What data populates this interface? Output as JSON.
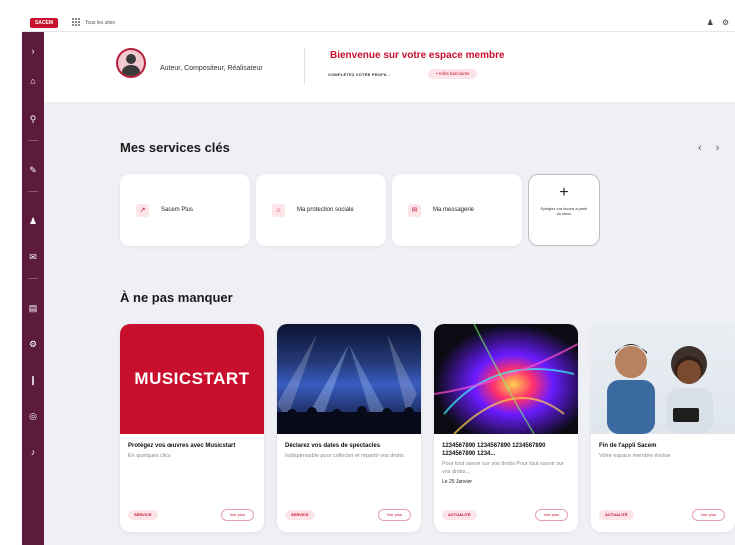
{
  "topbar": {
    "logo_text": "SACEM",
    "apps_label": "Tous les sites",
    "user_icon": "user-icon",
    "settings_icon": "gear-icon"
  },
  "sidebar": {
    "items": [
      {
        "icon": "chevron-right-icon",
        "glyph": "›"
      },
      {
        "icon": "home-icon",
        "glyph": "⌂"
      },
      {
        "icon": "search-icon",
        "glyph": "⚲"
      },
      {
        "icon": "pencil-icon",
        "glyph": "✎"
      },
      {
        "icon": "user-icon",
        "glyph": "♟"
      },
      {
        "icon": "mail-icon",
        "glyph": "✉"
      },
      {
        "icon": "document-icon",
        "glyph": "▤"
      },
      {
        "icon": "settings-icon",
        "glyph": "⚙"
      },
      {
        "icon": "microphone-icon",
        "glyph": "❙"
      },
      {
        "icon": "money-icon",
        "glyph": "◎"
      },
      {
        "icon": "music-note-icon",
        "glyph": "♪"
      }
    ]
  },
  "welcome": {
    "role": "Auteur, Compositeur, Réalisateur",
    "title": "Bienvenue sur votre espace membre",
    "complete_label": "COMPLÉTEZ VOTRE PROFIL :",
    "pill": "• Infos bancaires"
  },
  "services": {
    "title": "Mes services clés",
    "items": [
      {
        "label": "Sacem Plus",
        "icon": "sacem-plus-icon",
        "glyph": "↗"
      },
      {
        "label": "Ma protection sociale",
        "icon": "home-icon",
        "glyph": "⌂"
      },
      {
        "label": "Ma messagerie",
        "icon": "mail-icon",
        "glyph": "✉"
      }
    ],
    "add": {
      "plus": "+",
      "label": "Epinglez vos favoris à partir du menu"
    }
  },
  "articles": {
    "title": "À ne pas manquer",
    "items": [
      {
        "title": "Protégez vos œuvres avec Musicstart",
        "subtitle": "En quelques clics",
        "date": "",
        "tag": "SERVICE",
        "button": "Voir plus",
        "image_text": "MUSICSTART"
      },
      {
        "title": "Déclarez vos dates de spectacles",
        "subtitle": "Indispensable pour collecter et répartir vos droits",
        "date": "",
        "tag": "SERVICE",
        "button": "Voir plus",
        "image_text": ""
      },
      {
        "title": "1234567890 1234567890 1234567890 1234567890 1234...",
        "subtitle": "Pour tout savoir sur vos droits Pour tout savoir sur vos droits...",
        "date": "Le 25 Janvier",
        "tag": "ACTUALITÉ",
        "button": "Voir plus",
        "image_text": ""
      },
      {
        "title": "Fin de l'appli Sacem",
        "subtitle": "Votre espace membre évolue",
        "date": "",
        "tag": "ACTUALITÉ",
        "button": "Voir plus",
        "image_text": ""
      }
    ]
  },
  "colors": {
    "accent": "#c8102e",
    "sidebar": "#5c1a3c",
    "background": "#eef0f5"
  }
}
